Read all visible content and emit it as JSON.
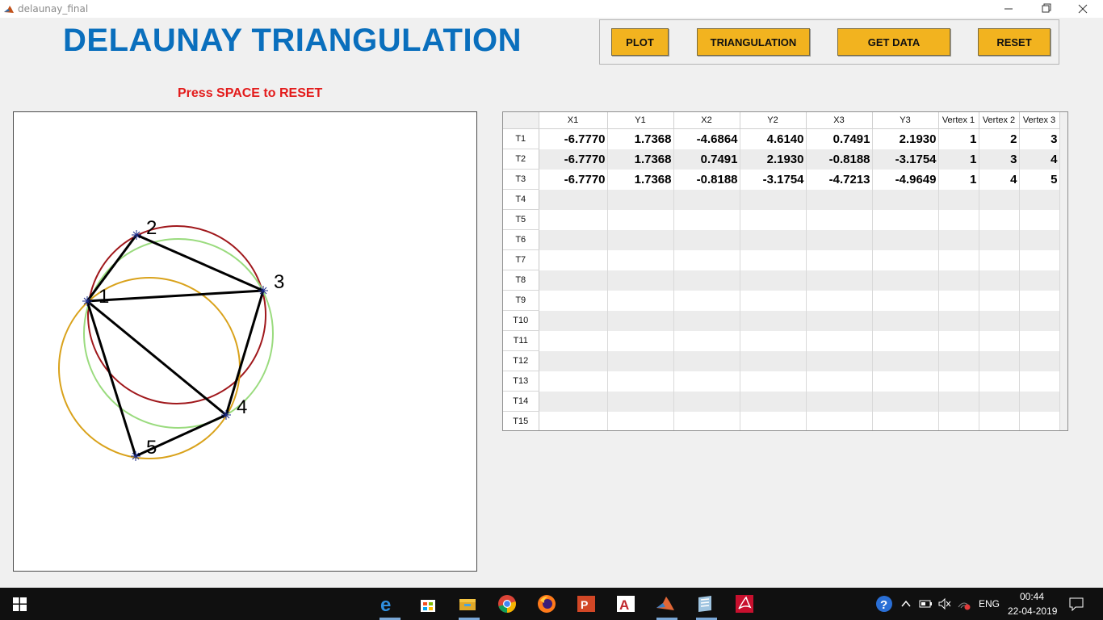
{
  "window": {
    "title": "delaunay_final"
  },
  "heading": "DELAUNAY TRIANGULATION",
  "buttons": {
    "plot": "PLOT",
    "triangulation": "TRIANGULATION",
    "get_data": "GET DATA",
    "reset": "RESET"
  },
  "instruction": "Press SPACE to RESET",
  "plot": {
    "point_labels": [
      "1",
      "2",
      "3",
      "4",
      "5"
    ],
    "circle_colors": [
      "#a0181c",
      "#9adb7e",
      "#d9a21b"
    ],
    "edge_color": "#000000"
  },
  "table": {
    "columns": [
      "X1",
      "Y1",
      "X2",
      "Y2",
      "X3",
      "Y3",
      "Vertex 1",
      "Vertex 2",
      "Vertex 3"
    ],
    "row_labels": [
      "T1",
      "T2",
      "T3",
      "T4",
      "T5",
      "T6",
      "T7",
      "T8",
      "T9",
      "T10",
      "T11",
      "T12",
      "T13",
      "T14",
      "T15"
    ],
    "rows": [
      [
        "-6.7770",
        "1.7368",
        "-4.6864",
        "4.6140",
        "0.7491",
        "2.1930",
        "1",
        "2",
        "3"
      ],
      [
        "-6.7770",
        "1.7368",
        "0.7491",
        "2.1930",
        "-0.8188",
        "-3.1754",
        "1",
        "3",
        "4"
      ],
      [
        "-6.7770",
        "1.7368",
        "-0.8188",
        "-3.1754",
        "-4.7213",
        "-4.9649",
        "1",
        "4",
        "5"
      ]
    ]
  },
  "taskbar": {
    "language": "ENG",
    "time": "00:44",
    "date": "22-04-2019"
  }
}
